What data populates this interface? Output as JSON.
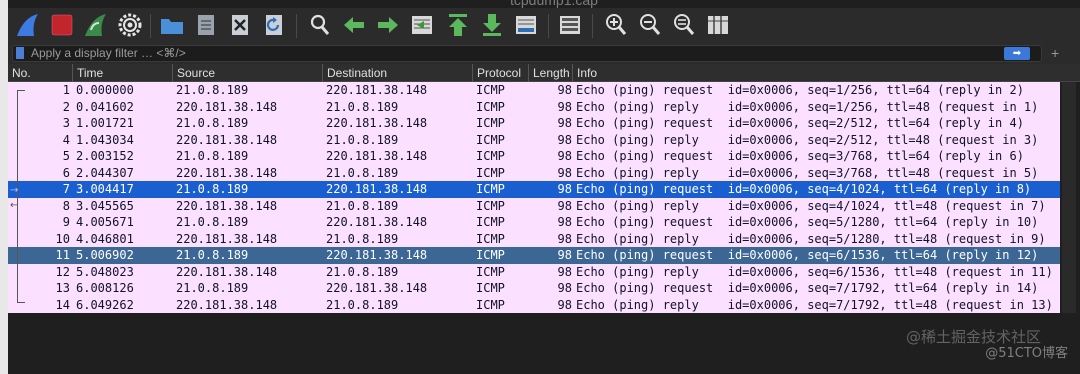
{
  "window": {
    "title_fragment": "tcpdump1.cap"
  },
  "toolbar": {
    "buttons": [
      {
        "icon": "shark-fin-start-icon",
        "label": "Start capture"
      },
      {
        "icon": "stop-square-icon",
        "label": "Stop capture"
      },
      {
        "icon": "restart-fin-icon",
        "label": "Restart capture"
      },
      {
        "icon": "gear-icon",
        "label": "Capture options"
      },
      {
        "icon": "folder-icon",
        "label": "Open"
      },
      {
        "icon": "file-icon",
        "label": "Save"
      },
      {
        "icon": "close-file-icon",
        "label": "Close"
      },
      {
        "icon": "reload-icon",
        "label": "Reload"
      },
      {
        "icon": "search-icon",
        "label": "Find packet"
      },
      {
        "icon": "arrow-left-icon",
        "label": "Back"
      },
      {
        "icon": "arrow-right-icon",
        "label": "Forward"
      },
      {
        "icon": "go-to-packet-icon",
        "label": "Go to packet"
      },
      {
        "icon": "go-first-icon",
        "label": "First packet"
      },
      {
        "icon": "go-last-icon",
        "label": "Last packet"
      },
      {
        "icon": "autoscroll-icon",
        "label": "Auto scroll"
      },
      {
        "icon": "colorize-icon",
        "label": "Colorize"
      },
      {
        "icon": "zoom-in-icon",
        "label": "Zoom in"
      },
      {
        "icon": "zoom-out-icon",
        "label": "Zoom out"
      },
      {
        "icon": "zoom-reset-icon",
        "label": "Normal size"
      },
      {
        "icon": "resize-columns-icon",
        "label": "Resize columns"
      }
    ]
  },
  "filter": {
    "placeholder": "Apply a display filter … <⌘/>",
    "apply_icon": "arrow-right-icon",
    "add_label": "+"
  },
  "columns": [
    "No.",
    "Time",
    "Source",
    "Destination",
    "Protocol",
    "Length",
    "Info"
  ],
  "packets": [
    {
      "no": "1",
      "time": "0.000000",
      "src": "21.0.8.189",
      "dst": "220.181.38.148",
      "proto": "ICMP",
      "len": "98",
      "info": "Echo (ping) request  id=0x0006, seq=1/256, ttl=64 (reply in 2)"
    },
    {
      "no": "2",
      "time": "0.041602",
      "src": "220.181.38.148",
      "dst": "21.0.8.189",
      "proto": "ICMP",
      "len": "98",
      "info": "Echo (ping) reply    id=0x0006, seq=1/256, ttl=48 (request in 1)"
    },
    {
      "no": "3",
      "time": "1.001721",
      "src": "21.0.8.189",
      "dst": "220.181.38.148",
      "proto": "ICMP",
      "len": "98",
      "info": "Echo (ping) request  id=0x0006, seq=2/512, ttl=64 (reply in 4)"
    },
    {
      "no": "4",
      "time": "1.043034",
      "src": "220.181.38.148",
      "dst": "21.0.8.189",
      "proto": "ICMP",
      "len": "98",
      "info": "Echo (ping) reply    id=0x0006, seq=2/512, ttl=48 (request in 3)"
    },
    {
      "no": "5",
      "time": "2.003152",
      "src": "21.0.8.189",
      "dst": "220.181.38.148",
      "proto": "ICMP",
      "len": "98",
      "info": "Echo (ping) request  id=0x0006, seq=3/768, ttl=64 (reply in 6)"
    },
    {
      "no": "6",
      "time": "2.044307",
      "src": "220.181.38.148",
      "dst": "21.0.8.189",
      "proto": "ICMP",
      "len": "98",
      "info": "Echo (ping) reply    id=0x0006, seq=3/768, ttl=48 (request in 5)"
    },
    {
      "no": "7",
      "time": "3.004417",
      "src": "21.0.8.189",
      "dst": "220.181.38.148",
      "proto": "ICMP",
      "len": "98",
      "info": "Echo (ping) request  id=0x0006, seq=4/1024, ttl=64 (reply in 8)"
    },
    {
      "no": "8",
      "time": "3.045565",
      "src": "220.181.38.148",
      "dst": "21.0.8.189",
      "proto": "ICMP",
      "len": "98",
      "info": "Echo (ping) reply    id=0x0006, seq=4/1024, ttl=48 (request in 7)"
    },
    {
      "no": "9",
      "time": "4.005671",
      "src": "21.0.8.189",
      "dst": "220.181.38.148",
      "proto": "ICMP",
      "len": "98",
      "info": "Echo (ping) request  id=0x0006, seq=5/1280, ttl=64 (reply in 10)"
    },
    {
      "no": "10",
      "time": "4.046801",
      "src": "220.181.38.148",
      "dst": "21.0.8.189",
      "proto": "ICMP",
      "len": "98",
      "info": "Echo (ping) reply    id=0x0006, seq=5/1280, ttl=48 (request in 9)"
    },
    {
      "no": "11",
      "time": "5.006902",
      "src": "21.0.8.189",
      "dst": "220.181.38.148",
      "proto": "ICMP",
      "len": "98",
      "info": "Echo (ping) request  id=0x0006, seq=6/1536, ttl=64 (reply in 12)"
    },
    {
      "no": "12",
      "time": "5.048023",
      "src": "220.181.38.148",
      "dst": "21.0.8.189",
      "proto": "ICMP",
      "len": "98",
      "info": "Echo (ping) reply    id=0x0006, seq=6/1536, ttl=48 (request in 11)"
    },
    {
      "no": "13",
      "time": "6.008126",
      "src": "21.0.8.189",
      "dst": "220.181.38.148",
      "proto": "ICMP",
      "len": "98",
      "info": "Echo (ping) request  id=0x0006, seq=7/1792, ttl=64 (reply in 14)"
    },
    {
      "no": "14",
      "time": "6.049262",
      "src": "220.181.38.148",
      "dst": "21.0.8.189",
      "proto": "ICMP",
      "len": "98",
      "info": "Echo (ping) reply    id=0x0006, seq=7/1792, ttl=48 (request in 13)"
    }
  ],
  "selected_packet": "7",
  "related_packet": "11",
  "colors": {
    "row_bg": "#fce0ff",
    "selected_bg": "#1a5fcf",
    "related_bg": "#3c6693",
    "toolbar_bg": "#2b2b2b"
  },
  "watermark": {
    "line1": "@稀土掘金技术社区",
    "line2": "@51CTO博客"
  }
}
